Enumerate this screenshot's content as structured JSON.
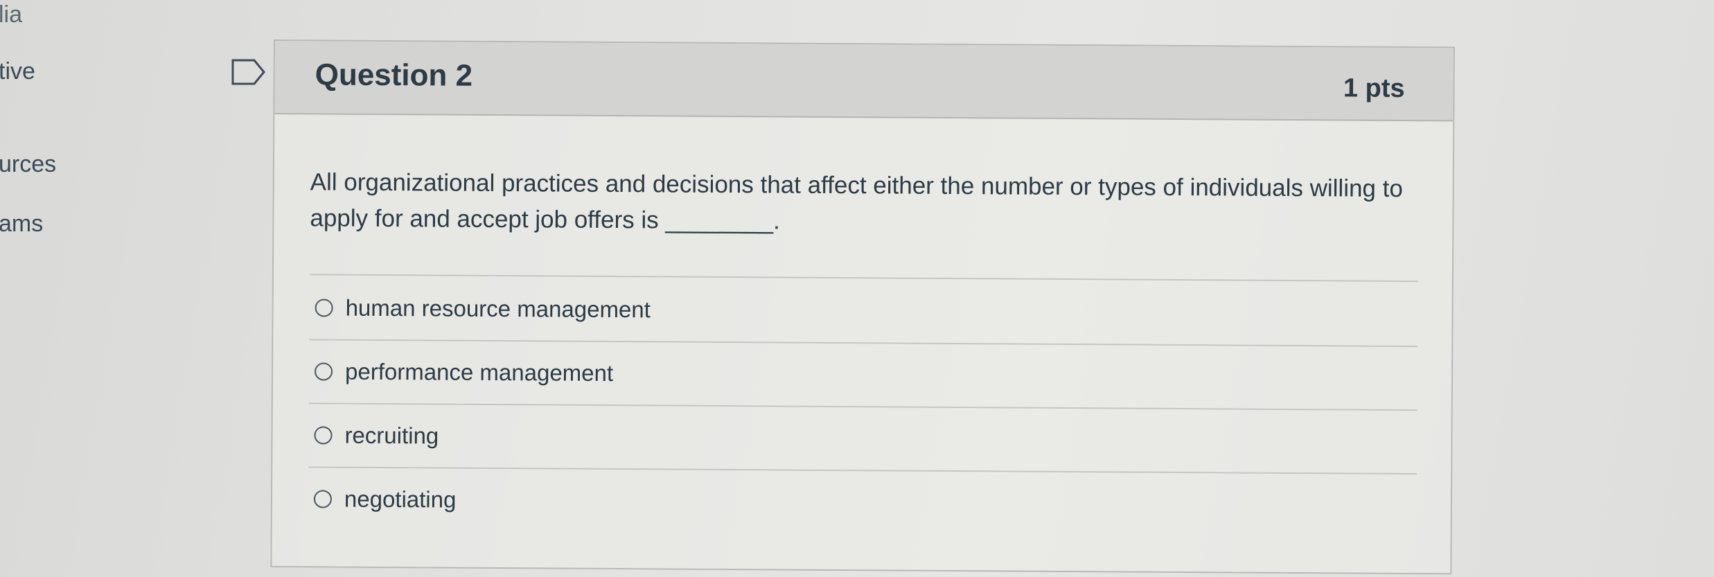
{
  "left_nav": {
    "items": [
      {
        "label": "lia"
      },
      {
        "label": "tive"
      },
      {
        "label": "urces"
      },
      {
        "label": "ams"
      }
    ]
  },
  "question": {
    "title": "Question 2",
    "points": "1 pts",
    "text": "All organizational practices and decisions that affect either the number or types of individuals willing to apply for and accept job offers is ________.",
    "answers": [
      {
        "label": "human resource management",
        "selected": false
      },
      {
        "label": "performance management",
        "selected": false
      },
      {
        "label": "recruiting",
        "selected": false
      },
      {
        "label": "negotiating",
        "selected": false
      }
    ]
  },
  "icons": {
    "flag": "flag-icon",
    "radio": "radio-unchecked-icon"
  },
  "colors": {
    "text": "#2d3b45",
    "header_bg": "#d3d3d1",
    "border": "#b9b9b7"
  }
}
